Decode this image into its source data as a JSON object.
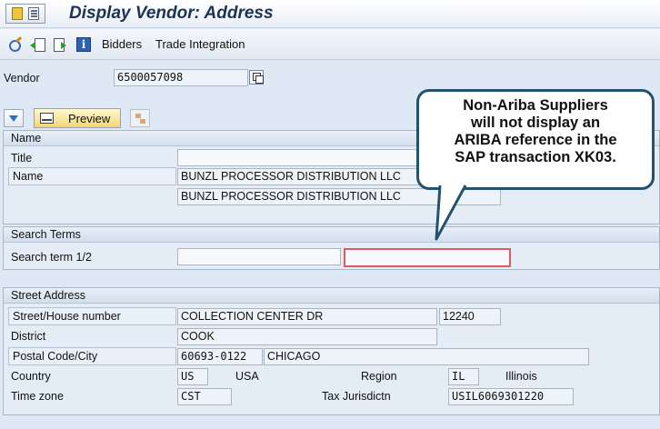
{
  "window": {
    "title": "Display Vendor: Address"
  },
  "toolbar": {
    "icons": [
      "display-change-icon",
      "previous-icon",
      "next-icon",
      "info-icon"
    ],
    "bidders_label": "Bidders",
    "trade_label": "Trade Integration"
  },
  "vendor": {
    "label": "Vendor",
    "value": "6500057098"
  },
  "actions": {
    "preview_label": "Preview"
  },
  "name_group": {
    "header": "Name",
    "title_label": "Title",
    "title_value": "",
    "name_label": "Name",
    "name1": "BUNZL PROCESSOR DISTRIBUTION LLC",
    "name2": "BUNZL PROCESSOR DISTRIBUTION LLC"
  },
  "search_group": {
    "header": "Search Terms",
    "label": "Search term 1/2",
    "term1": "",
    "term2": ""
  },
  "street_group": {
    "header": "Street Address",
    "street_label": "Street/House number",
    "street": "COLLECTION CENTER DR",
    "house_number": "12240",
    "district_label": "District",
    "district": "COOK",
    "postal_label": "Postal Code/City",
    "postal_code": "60693-0122",
    "city": "CHICAGO",
    "country_label": "Country",
    "country_code": "US",
    "country_name": "USA",
    "region_label": "Region",
    "region_code": "IL",
    "region_name": "Illinois",
    "timezone_label": "Time zone",
    "timezone": "CST",
    "tax_label": "Tax Jurisdictn",
    "tax_code": "USIL6069301220"
  },
  "callout": {
    "line1": "Non-Ariba Suppliers",
    "line2": "will not display an",
    "line3": "ARIBA  reference in the",
    "line4": "SAP transaction XK03."
  },
  "colors": {
    "title_text": "#1d3354",
    "callout_border": "#24516e",
    "highlight_box": "#e05a59",
    "preview_button": "#f1d774"
  }
}
